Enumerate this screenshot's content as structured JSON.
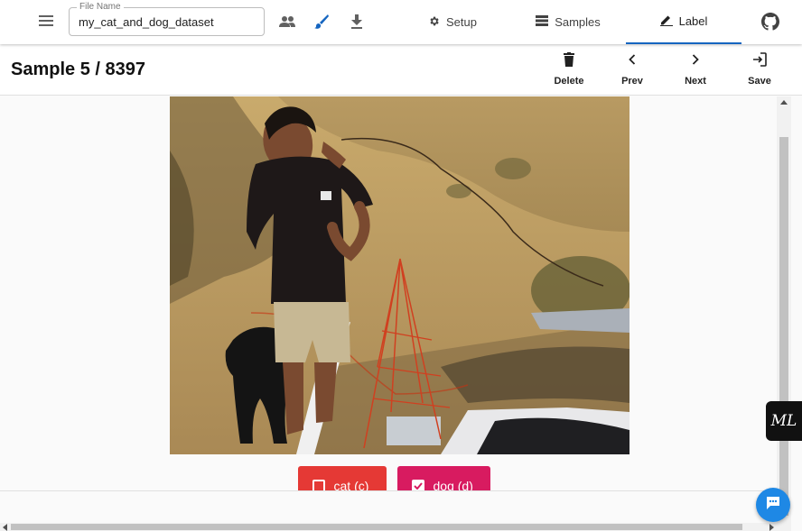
{
  "appbar": {
    "filename_legend": "File Name",
    "filename_value": "my_cat_and_dog_dataset",
    "tabs": [
      {
        "label": "Setup",
        "icon": "gear-icon"
      },
      {
        "label": "Samples",
        "icon": "list-icon"
      },
      {
        "label": "Label",
        "icon": "pencil-icon",
        "active": true
      }
    ],
    "tools": [
      "people-icon",
      "brush-icon",
      "download-icon"
    ]
  },
  "header": {
    "title": "Sample 5 / 8397",
    "actions": [
      {
        "label": "Delete",
        "icon": "trash-icon"
      },
      {
        "label": "Prev",
        "icon": "chevron-left-icon"
      },
      {
        "label": "Next",
        "icon": "chevron-right-icon"
      },
      {
        "label": "Save",
        "icon": "exit-icon"
      }
    ]
  },
  "labels": [
    {
      "label": "cat (c)",
      "checked": false,
      "color": "#e53935"
    },
    {
      "label": "dog (d)",
      "checked": true,
      "color": "#d81b60"
    }
  ],
  "widgets": {
    "badge_text": "ML"
  },
  "colors": {
    "accent": "#1565c0",
    "chat": "#1e88e5"
  }
}
